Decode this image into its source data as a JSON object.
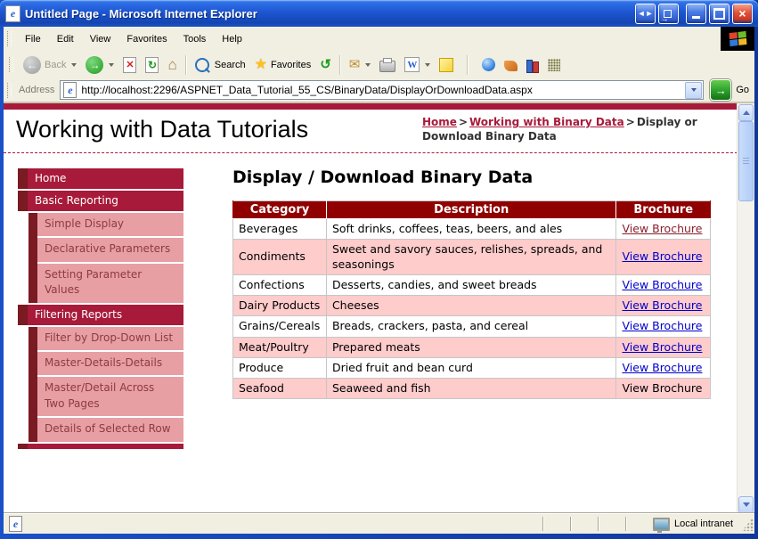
{
  "window": {
    "title": "Untitled Page - Microsoft Internet Explorer"
  },
  "menu_bar": {
    "items": [
      "File",
      "Edit",
      "View",
      "Favorites",
      "Tools",
      "Help"
    ]
  },
  "toolbar": {
    "back_label": "Back",
    "search_label": "Search",
    "favorites_label": "Favorites"
  },
  "address_bar": {
    "label": "Address",
    "url": "http://localhost:2296/ASPNET_Data_Tutorial_55_CS/BinaryData/DisplayOrDownloadData.aspx",
    "go_label": "Go"
  },
  "page": {
    "site_title": "Working with Data Tutorials",
    "breadcrumb": {
      "home": "Home",
      "separator": ">",
      "section": "Working with Binary Data",
      "current": "Display or Download Binary Data"
    },
    "sidebar": {
      "items": [
        {
          "label": "Home",
          "level": "top"
        },
        {
          "label": "Basic Reporting",
          "level": "top"
        },
        {
          "label": "Simple Display",
          "level": "sub"
        },
        {
          "label": "Declarative Parameters",
          "level": "sub"
        },
        {
          "label": "Setting Parameter Values",
          "level": "sub"
        },
        {
          "label": "Filtering Reports",
          "level": "top"
        },
        {
          "label": "Filter by Drop-Down List",
          "level": "sub"
        },
        {
          "label": "Master-Details-Details",
          "level": "sub"
        },
        {
          "label": "Master/Detail Across Two Pages",
          "level": "sub"
        },
        {
          "label": "Details of Selected Row",
          "level": "sub"
        }
      ]
    },
    "main": {
      "heading": "Display / Download Binary Data",
      "table": {
        "headers": [
          "Category",
          "Description",
          "Brochure"
        ],
        "rows": [
          {
            "category": "Beverages",
            "description": "Soft drinks, coffees, teas, beers, and ales",
            "brochure": "View Brochure",
            "brochure_state": "visited-link"
          },
          {
            "category": "Condiments",
            "description": "Sweet and savory sauces, relishes, spreads, and seasonings",
            "brochure": "View Brochure",
            "brochure_state": "link"
          },
          {
            "category": "Confections",
            "description": "Desserts, candies, and sweet breads",
            "brochure": "View Brochure",
            "brochure_state": "link"
          },
          {
            "category": "Dairy Products",
            "description": "Cheeses",
            "brochure": "View Brochure",
            "brochure_state": "link"
          },
          {
            "category": "Grains/Cereals",
            "description": "Breads, crackers, pasta, and cereal",
            "brochure": "View Brochure",
            "brochure_state": "link"
          },
          {
            "category": "Meat/Poultry",
            "description": "Prepared meats",
            "brochure": "View Brochure",
            "brochure_state": "link"
          },
          {
            "category": "Produce",
            "description": "Dried fruit and bean curd",
            "brochure": "View Brochure",
            "brochure_state": "link"
          },
          {
            "category": "Seafood",
            "description": "Seaweed and fish",
            "brochure": "View Brochure",
            "brochure_state": "plain-text"
          }
        ]
      }
    }
  },
  "status_bar": {
    "zone_label": "Local intranet"
  },
  "icons": {
    "app-icon": "ie-page-with-blue-e",
    "resize-horizontal-icon": "left-right arrows",
    "popout-icon": "arrow leaving box",
    "minimize-icon": "bar",
    "maximize-icon": "square",
    "close-icon": "x",
    "windows-flag-icon": "four color squares",
    "back-icon": "gray circle left arrow",
    "forward-icon": "green circle right arrow",
    "stop-icon": "document with red x",
    "refresh-icon": "document with green arrows",
    "home-icon": "house",
    "search-icon": "magnifier",
    "favorites-icon": "gold star",
    "history-icon": "green circular arrow",
    "mail-icon": "envelope",
    "print-icon": "printer",
    "edit-word-icon": "W box",
    "discuss-icon": "yellow note",
    "messenger-icon": "blue orb",
    "plugin-icon-1": "orange shape",
    "research-icon": "books",
    "plugin-icon-2": "dot grid",
    "go-icon": "green square right arrow",
    "intranet-icon": "monitor"
  },
  "colors": {
    "theme_crimson": "#A81A3A",
    "accent_maroon": "#7A1A22",
    "menu_pink": "#E79FA4",
    "menu_sub_text": "#8D3A42",
    "table_header_red": "#900000",
    "row_pink": "#FFCCCC",
    "link_blue": "#0000CC",
    "link_visited": "#8A1F2B",
    "titlebar_blue": "#1E56D2",
    "chrome_tan": "#F1EFE2"
  }
}
